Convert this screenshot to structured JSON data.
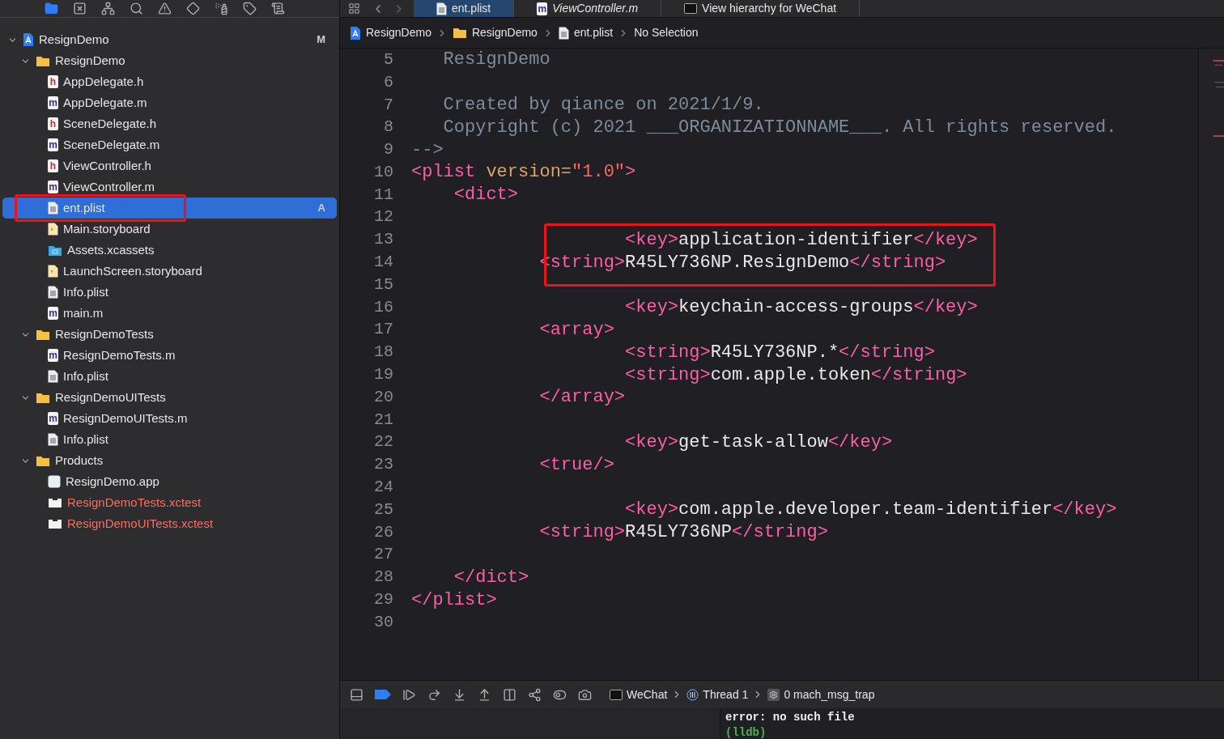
{
  "navigator": {
    "tree": [
      {
        "name": "ResignDemo",
        "kind": "project",
        "badge": "M",
        "selected": false,
        "expanded": true,
        "children": [
          {
            "name": "ResignDemo",
            "kind": "folder",
            "selected": false,
            "expanded": true,
            "children": [
              {
                "name": "AppDelegate.h",
                "kind": "source",
                "glyph": "h",
                "selected": false,
                "annotated": false
              },
              {
                "name": "AppDelegate.m",
                "kind": "source",
                "glyph": "m",
                "selected": false,
                "annotated": false
              },
              {
                "name": "SceneDelegate.h",
                "kind": "source",
                "glyph": "h",
                "selected": false,
                "annotated": false
              },
              {
                "name": "SceneDelegate.m",
                "kind": "source",
                "glyph": "m",
                "selected": false,
                "annotated": false
              },
              {
                "name": "ViewController.h",
                "kind": "source",
                "glyph": "h",
                "selected": false,
                "annotated": false
              },
              {
                "name": "ViewController.m",
                "kind": "source",
                "glyph": "m",
                "selected": false,
                "annotated": false
              },
              {
                "name": "ent.plist",
                "kind": "plist",
                "badge": "A",
                "selected": true,
                "annotated": true
              },
              {
                "name": "Main.storyboard",
                "kind": "storyboard",
                "selected": false,
                "annotated": false
              },
              {
                "name": "Assets.xcassets",
                "kind": "assets",
                "selected": false,
                "annotated": false
              },
              {
                "name": "LaunchScreen.storyboard",
                "kind": "storyboard",
                "selected": false,
                "annotated": false
              },
              {
                "name": "Info.plist",
                "kind": "plist",
                "selected": false,
                "annotated": false
              },
              {
                "name": "main.m",
                "kind": "source",
                "glyph": "m",
                "selected": false,
                "annotated": false
              }
            ]
          },
          {
            "name": "ResignDemoTests",
            "kind": "folder",
            "selected": false,
            "expanded": true,
            "children": [
              {
                "name": "ResignDemoTests.m",
                "kind": "source",
                "glyph": "m",
                "selected": false
              },
              {
                "name": "Info.plist",
                "kind": "plist",
                "selected": false
              }
            ]
          },
          {
            "name": "ResignDemoUITests",
            "kind": "folder",
            "selected": false,
            "expanded": true,
            "children": [
              {
                "name": "ResignDemoUITests.m",
                "kind": "source",
                "glyph": "m",
                "selected": false
              },
              {
                "name": "Info.plist",
                "kind": "plist",
                "selected": false
              }
            ]
          },
          {
            "name": "Products",
            "kind": "folder",
            "selected": false,
            "expanded": true,
            "children": [
              {
                "name": "ResignDemo.app",
                "kind": "app",
                "selected": false,
                "missing": false
              },
              {
                "name": "ResignDemoTests.xctest",
                "kind": "bundle",
                "selected": false,
                "missing": true
              },
              {
                "name": "ResignDemoUITests.xctest",
                "kind": "bundle",
                "selected": false,
                "missing": true
              }
            ]
          }
        ]
      }
    ]
  },
  "tabs": [
    {
      "label": "ent.plist",
      "kind": "plist",
      "selected": true,
      "italic": false
    },
    {
      "label": "ViewController.m",
      "kind": "source",
      "glyph": "m",
      "selected": false,
      "italic": true
    },
    {
      "label": "View hierarchy for WeChat",
      "kind": "terminal",
      "selected": false,
      "italic": false
    }
  ],
  "breadcrumb": [
    {
      "label": "ResignDemo",
      "kind": "project"
    },
    {
      "label": "ResignDemo",
      "kind": "folder"
    },
    {
      "label": "ent.plist",
      "kind": "plist"
    },
    {
      "label": "No Selection",
      "kind": "none"
    }
  ],
  "editor": {
    "lines": [
      {
        "number": "5",
        "annotated": false,
        "tokens": [
          {
            "kind": "comment",
            "text": "   ResignDemo"
          }
        ]
      },
      {
        "number": "6",
        "annotated": false
      },
      {
        "number": "7",
        "annotated": false,
        "tokens": [
          {
            "kind": "comment",
            "text": "   Created by qiance on 2021/1/9."
          }
        ]
      },
      {
        "number": "8",
        "annotated": false,
        "tokens": [
          {
            "kind": "comment",
            "text": "   Copyright (c) 2021 ___ORGANIZATIONNAME___. All rights reserved."
          }
        ]
      },
      {
        "number": "9",
        "annotated": false,
        "tokens": [
          {
            "kind": "comment",
            "text": "-->"
          }
        ]
      },
      {
        "number": "10",
        "annotated": false,
        "tokens": [
          {
            "kind": "tag",
            "text": "<plist"
          },
          {
            "kind": "attr",
            "text": " version="
          },
          {
            "kind": "value",
            "text": "\"1.0\""
          },
          {
            "kind": "tag",
            "text": ">"
          }
        ]
      },
      {
        "number": "11",
        "annotated": false,
        "tokens": [
          {
            "kind": "tag",
            "text": "    <dict>"
          }
        ]
      },
      {
        "number": "12",
        "annotated": false
      },
      {
        "number": "13",
        "annotated": true,
        "tokens": [
          {
            "kind": "tag",
            "text": "                    <key>"
          },
          {
            "kind": "text",
            "text": "application-identifier"
          },
          {
            "kind": "tag",
            "text": "</key>"
          }
        ]
      },
      {
        "number": "14",
        "annotated": true,
        "tokens": [
          {
            "kind": "tag",
            "text": "            <string>"
          },
          {
            "kind": "text",
            "text": "R45LY736NP.ResignDemo"
          },
          {
            "kind": "tag",
            "text": "</string>"
          }
        ]
      },
      {
        "number": "15",
        "annotated": false
      },
      {
        "number": "16",
        "annotated": false,
        "tokens": [
          {
            "kind": "tag",
            "text": "                    <key>"
          },
          {
            "kind": "text",
            "text": "keychain-access-groups"
          },
          {
            "kind": "tag",
            "text": "</key>"
          }
        ]
      },
      {
        "number": "17",
        "annotated": false,
        "tokens": [
          {
            "kind": "tag",
            "text": "            <array>"
          }
        ]
      },
      {
        "number": "18",
        "annotated": false,
        "tokens": [
          {
            "kind": "tag",
            "text": "                    <string>"
          },
          {
            "kind": "text",
            "text": "R45LY736NP.*"
          },
          {
            "kind": "tag",
            "text": "</string>"
          }
        ]
      },
      {
        "number": "19",
        "annotated": false,
        "tokens": [
          {
            "kind": "tag",
            "text": "                    <string>"
          },
          {
            "kind": "text",
            "text": "com.apple.token"
          },
          {
            "kind": "tag",
            "text": "</string>"
          }
        ]
      },
      {
        "number": "20",
        "annotated": false,
        "tokens": [
          {
            "kind": "tag",
            "text": "            </array>"
          }
        ]
      },
      {
        "number": "21",
        "annotated": false
      },
      {
        "number": "22",
        "annotated": false,
        "tokens": [
          {
            "kind": "tag",
            "text": "                    <key>"
          },
          {
            "kind": "text",
            "text": "get-task-allow"
          },
          {
            "kind": "tag",
            "text": "</key>"
          }
        ]
      },
      {
        "number": "23",
        "annotated": false,
        "tokens": [
          {
            "kind": "tag",
            "text": "            <true/>"
          }
        ]
      },
      {
        "number": "24",
        "annotated": false
      },
      {
        "number": "25",
        "annotated": false,
        "tokens": [
          {
            "kind": "tag",
            "text": "                    <key>"
          },
          {
            "kind": "text",
            "text": "com.apple.developer.team-identifier"
          },
          {
            "kind": "tag",
            "text": "</key>"
          }
        ]
      },
      {
        "number": "26",
        "annotated": false,
        "tokens": [
          {
            "kind": "tag",
            "text": "            <string>"
          },
          {
            "kind": "text",
            "text": "R45LY736NP"
          },
          {
            "kind": "tag",
            "text": "</string>"
          }
        ]
      },
      {
        "number": "27",
        "annotated": false
      },
      {
        "number": "28",
        "annotated": false,
        "tokens": [
          {
            "kind": "tag",
            "text": "    </dict>"
          }
        ]
      },
      {
        "number": "29",
        "annotated": false,
        "tokens": [
          {
            "kind": "tag",
            "text": "</plist>"
          }
        ]
      },
      {
        "number": "30",
        "annotated": false
      }
    ]
  },
  "debug_bar": {
    "breakpoints_active": true,
    "path": [
      {
        "label": "WeChat",
        "kind": "terminal"
      },
      {
        "label": "Thread 1",
        "kind": "thread"
      },
      {
        "label": "0 mach_msg_trap",
        "kind": "gear"
      }
    ]
  },
  "console": {
    "lines": [
      {
        "kind": "output",
        "text": "error: no such file"
      },
      {
        "kind": "prompt",
        "text": "(lldb)"
      }
    ]
  }
}
